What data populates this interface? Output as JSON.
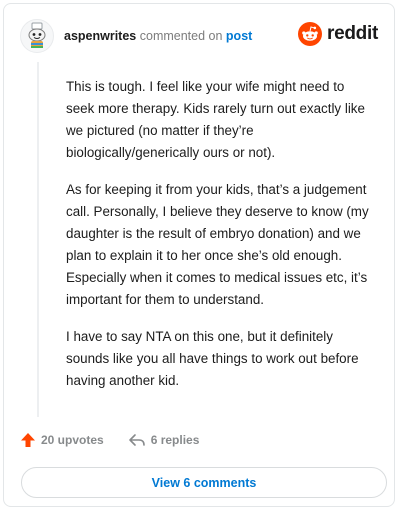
{
  "comment": {
    "username": "aspenwrites",
    "action_text": "commented on",
    "target_link": "post",
    "avatar_icon": "snoo-avatar-icon",
    "paragraphs": [
      "This is tough. I feel like your wife might need to seek more therapy. Kids rarely turn out exactly like we pictured (no matter if they’re biologically/generically ours or not).",
      "As for keeping it from your kids, that’s a judgement call. Personally, I believe they deserve to know (my daughter is the result of embryo donation) and we plan to explain it to her once she’s old enough. Especially when it comes to medical issues etc, it’s important for them to understand.",
      "I have to say NTA on this one, but it definitely sounds like you all have things to work out before having another kid."
    ]
  },
  "brand": {
    "name": "reddit",
    "color": "#ff4500"
  },
  "actions": {
    "upvotes": "20 upvotes",
    "upvote_icon": "upvote-arrow-icon",
    "upvote_color": "#ff4500",
    "replies": "6 replies",
    "reply_icon": "reply-arrow-icon"
  },
  "footer": {
    "view_comments": "View 6 comments"
  },
  "colors": {
    "link": "#0079d3",
    "text": "#1c1c1c",
    "muted": "#878a8c"
  }
}
